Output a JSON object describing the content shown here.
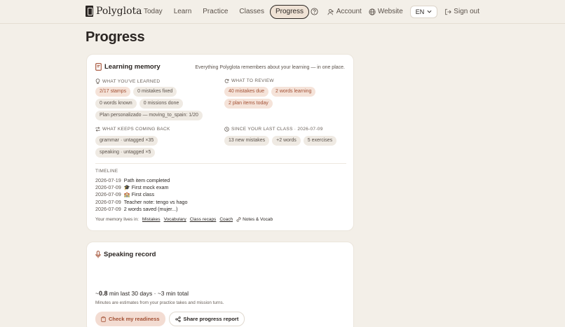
{
  "nav": {
    "brand": "Polyglota",
    "links": [
      "Today",
      "Learn",
      "Practice",
      "Classes",
      "Progress"
    ],
    "active_link": "Progress",
    "account": "Account",
    "website": "Website",
    "language": "EN",
    "signout": "Sign out"
  },
  "page": {
    "title": "Progress"
  },
  "memory": {
    "title": "Learning memory",
    "note": "Everything Polyglota remembers about your learning — in one place.",
    "learned": {
      "title": "WHAT YOU'VE LEARNED",
      "chips": [
        "2/17 stamps",
        "0 mistakes fixed",
        "0 words known",
        "0 missions done",
        "Plan personalizado — moving_to_spain: 1/20"
      ]
    },
    "review": {
      "title": "WHAT TO REVIEW",
      "chips": [
        "40 mistakes due",
        "2 words learning",
        "2 plan items today"
      ]
    },
    "coming_back": {
      "title": "WHAT KEEPS COMING BACK",
      "chips": [
        "grammar · untagged ×35",
        "speaking · untagged ×5"
      ]
    },
    "since_class": {
      "title": "SINCE YOUR LAST CLASS · 2026-07-09",
      "chips": [
        "13 new mistakes",
        "+2 words",
        "5 exercises"
      ]
    },
    "timeline": {
      "title": "TIMELINE",
      "rows": [
        {
          "date": "2026-07-19",
          "text": "Path item completed"
        },
        {
          "date": "2026-07-09",
          "text": "🎓 First mock exam"
        },
        {
          "date": "2026-07-09",
          "text": "🏫 First class"
        },
        {
          "date": "2026-07-09",
          "text": "Teacher note: tengo vs hago"
        },
        {
          "date": "2026-07-09",
          "text": "2 words saved (mujer...)"
        }
      ]
    },
    "links": {
      "prefix": "Your memory lives in:",
      "items": [
        "Mistakes",
        "Vocabulary",
        "Class recaps",
        "Coach"
      ],
      "notes": "Notes & Vocab"
    }
  },
  "speaking": {
    "title": "Speaking record",
    "tilde": "~",
    "minutes": "0.8",
    "stat_rest": "min last 30 days · ~3 min total",
    "note": "Minutes are estimates from your practice takes and mission turns.",
    "btn_readiness": "Check my readiness",
    "btn_share": "Share progress report"
  },
  "colors": {
    "accent": "#a24f33",
    "accent_bg": "#f5e3d9",
    "page_bg": "#f3efe8"
  },
  "icons": [
    "logo-icon",
    "help-icon",
    "account-icon",
    "globe-icon",
    "chevron-down-icon",
    "signout-icon",
    "book-icon",
    "lightbulb-icon",
    "refresh-icon",
    "repeat-icon",
    "clock-icon",
    "link-icon",
    "mic-icon",
    "clipboard-icon",
    "share-icon"
  ]
}
